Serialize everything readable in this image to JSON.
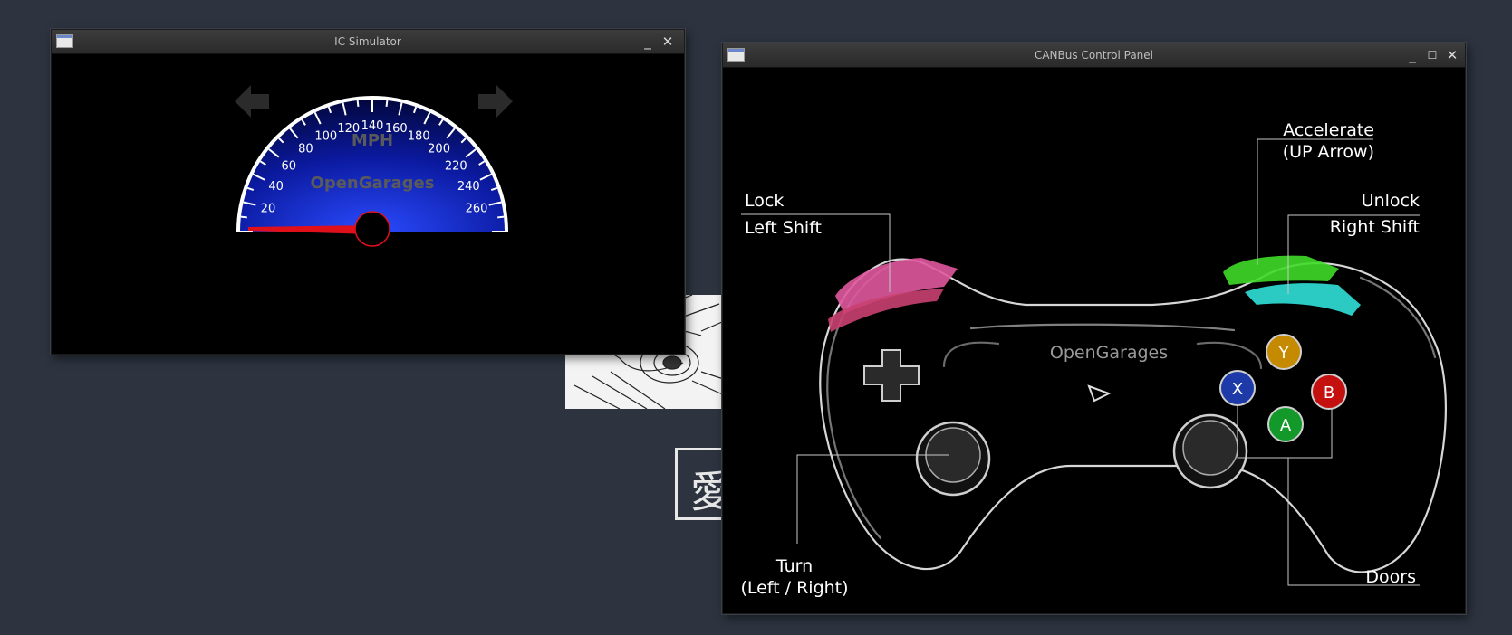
{
  "ic_window": {
    "title": "IC Simulator",
    "speedometer": {
      "unit": "MPH",
      "brand": "OpenGarages",
      "tick_labels": [
        "20",
        "40",
        "60",
        "80",
        "100",
        "120",
        "140",
        "160",
        "180",
        "200",
        "220",
        "240",
        "260"
      ],
      "speed": 0
    },
    "left_signal": "left-arrow-icon",
    "right_signal": "right-arrow-icon"
  },
  "panel_window": {
    "title": "CANBus Control Panel",
    "brand": "OpenGarages",
    "labels": {
      "accelerate_line1": "Accelerate",
      "accelerate_line2": "(UP Arrow)",
      "lock_line1": "Lock",
      "lock_line2": "Left Shift",
      "unlock_line1": "Unlock",
      "unlock_line2": "Right Shift",
      "turn_line1": "Turn",
      "turn_line2": "(Left / Right)",
      "doors": "Doors"
    },
    "buttons": {
      "y": "Y",
      "x": "X",
      "b": "B",
      "a": "A"
    }
  },
  "background": {
    "kanji": "愛"
  },
  "colors": {
    "desktop": "#2d333f",
    "gauge_blue": "#1a2cd8",
    "needle": "#e0101b",
    "btn_y": "#c58a00",
    "btn_x": "#1d3aa8",
    "btn_b": "#c51010",
    "btn_a": "#13992a",
    "bumper_left": "#e0589f",
    "trigger_right": "#3fdb28",
    "bumper_right": "#30e0d8"
  }
}
